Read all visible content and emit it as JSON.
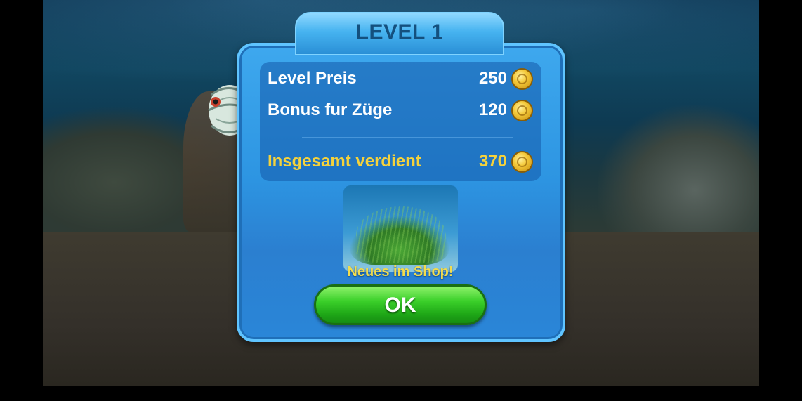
{
  "dialog": {
    "title": "LEVEL 1",
    "rows": [
      {
        "label": "Level Preis",
        "value": "250",
        "icon": "coin-icon"
      },
      {
        "label": "Bonus fur Züge",
        "value": "120",
        "icon": "coin-icon"
      }
    ],
    "total": {
      "label": "Insgesamt verdient",
      "value": "370",
      "icon": "coin-icon"
    },
    "shop_notice": "Neues im Shop!",
    "ok_label": "OK"
  },
  "colors": {
    "panel_blue": "#2d95e2",
    "title_text": "#14507e",
    "highlight_gold": "#f4d23c",
    "ok_green": "#3bd02a"
  }
}
